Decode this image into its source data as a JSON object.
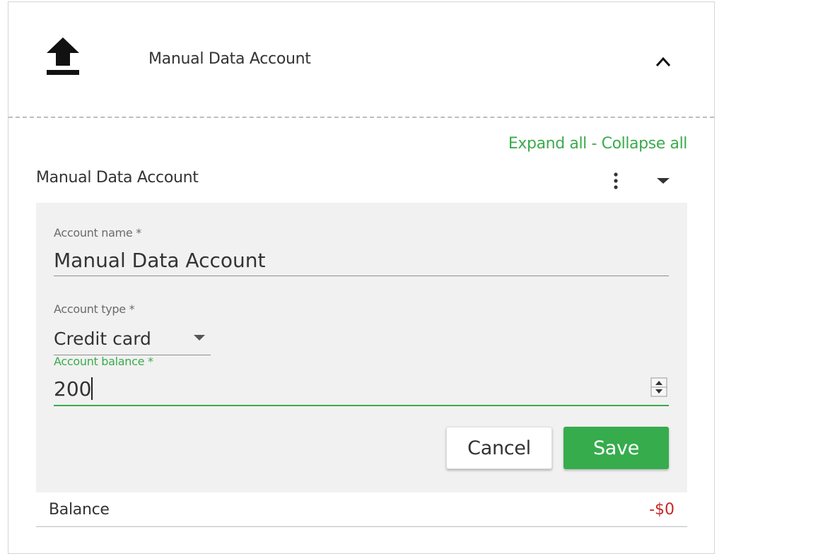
{
  "header": {
    "title": "Manual Data Account",
    "icon": "upload-icon",
    "collapse_icon": "chevron-up-icon"
  },
  "controls": {
    "expand_all": "Expand all",
    "separator": " - ",
    "collapse_all": "Collapse all"
  },
  "account": {
    "title": "Manual Data Account",
    "menu_icon": "kebab-icon",
    "toggle_icon": "caret-down-icon"
  },
  "form": {
    "name_label": "Account name *",
    "name_value": "Manual Data Account",
    "type_label": "Account type *",
    "type_value": "Credit card",
    "balance_label": "Account balance *",
    "balance_value": "200",
    "cancel_label": "Cancel",
    "save_label": "Save"
  },
  "summary": {
    "balance_label": "Balance",
    "balance_value": "-$0"
  },
  "colors": {
    "accent": "#3aab4d",
    "save_button": "#36ac4c",
    "negative": "#c62828",
    "panel": "#f1f1f1"
  }
}
